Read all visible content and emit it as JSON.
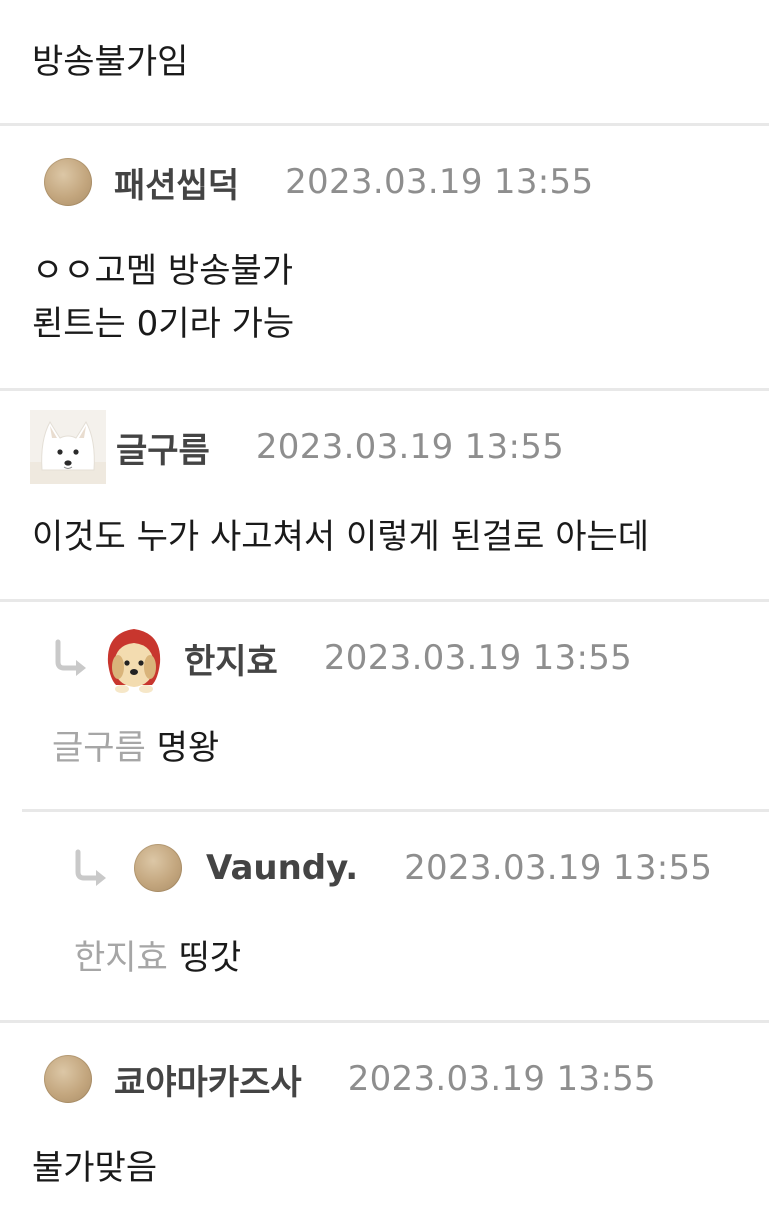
{
  "post": {
    "body_tail": "방송불가임"
  },
  "comments": [
    {
      "nickname": "패션씹덕",
      "timestamp": "2023.03.19 13:55",
      "avatar": "default-avatar-icon",
      "lines": [
        "ㅇㅇ고멤 방송불가",
        "뢴트는 0기라 가능"
      ]
    },
    {
      "nickname": "글구름",
      "timestamp": "2023.03.19 13:55",
      "avatar": "white-fox-avatar",
      "lines": [
        "이것도 누가 사고쳐서 이렇게 된걸로 아는데"
      ]
    },
    {
      "nickname": "한지효",
      "timestamp": "2023.03.19 13:55",
      "avatar": "puppy-red-hood-avatar",
      "reply_to": "글구름",
      "text": "명왕"
    },
    {
      "nickname": "Vaundy.",
      "timestamp": "2023.03.19 13:55",
      "avatar": "default-avatar-icon",
      "reply_to": "한지효",
      "text": "띵갓"
    },
    {
      "nickname": "쿄야마카즈사",
      "timestamp": "2023.03.19 13:55",
      "avatar": "default-avatar-icon",
      "lines": [
        "불가맞음"
      ]
    }
  ],
  "colors": {
    "nickname": "#444444",
    "timestamp": "#8e8e8e",
    "mention": "#a6a6a6",
    "divider": "#e8e8e8",
    "reply_arrow": "#c9c9c9"
  }
}
